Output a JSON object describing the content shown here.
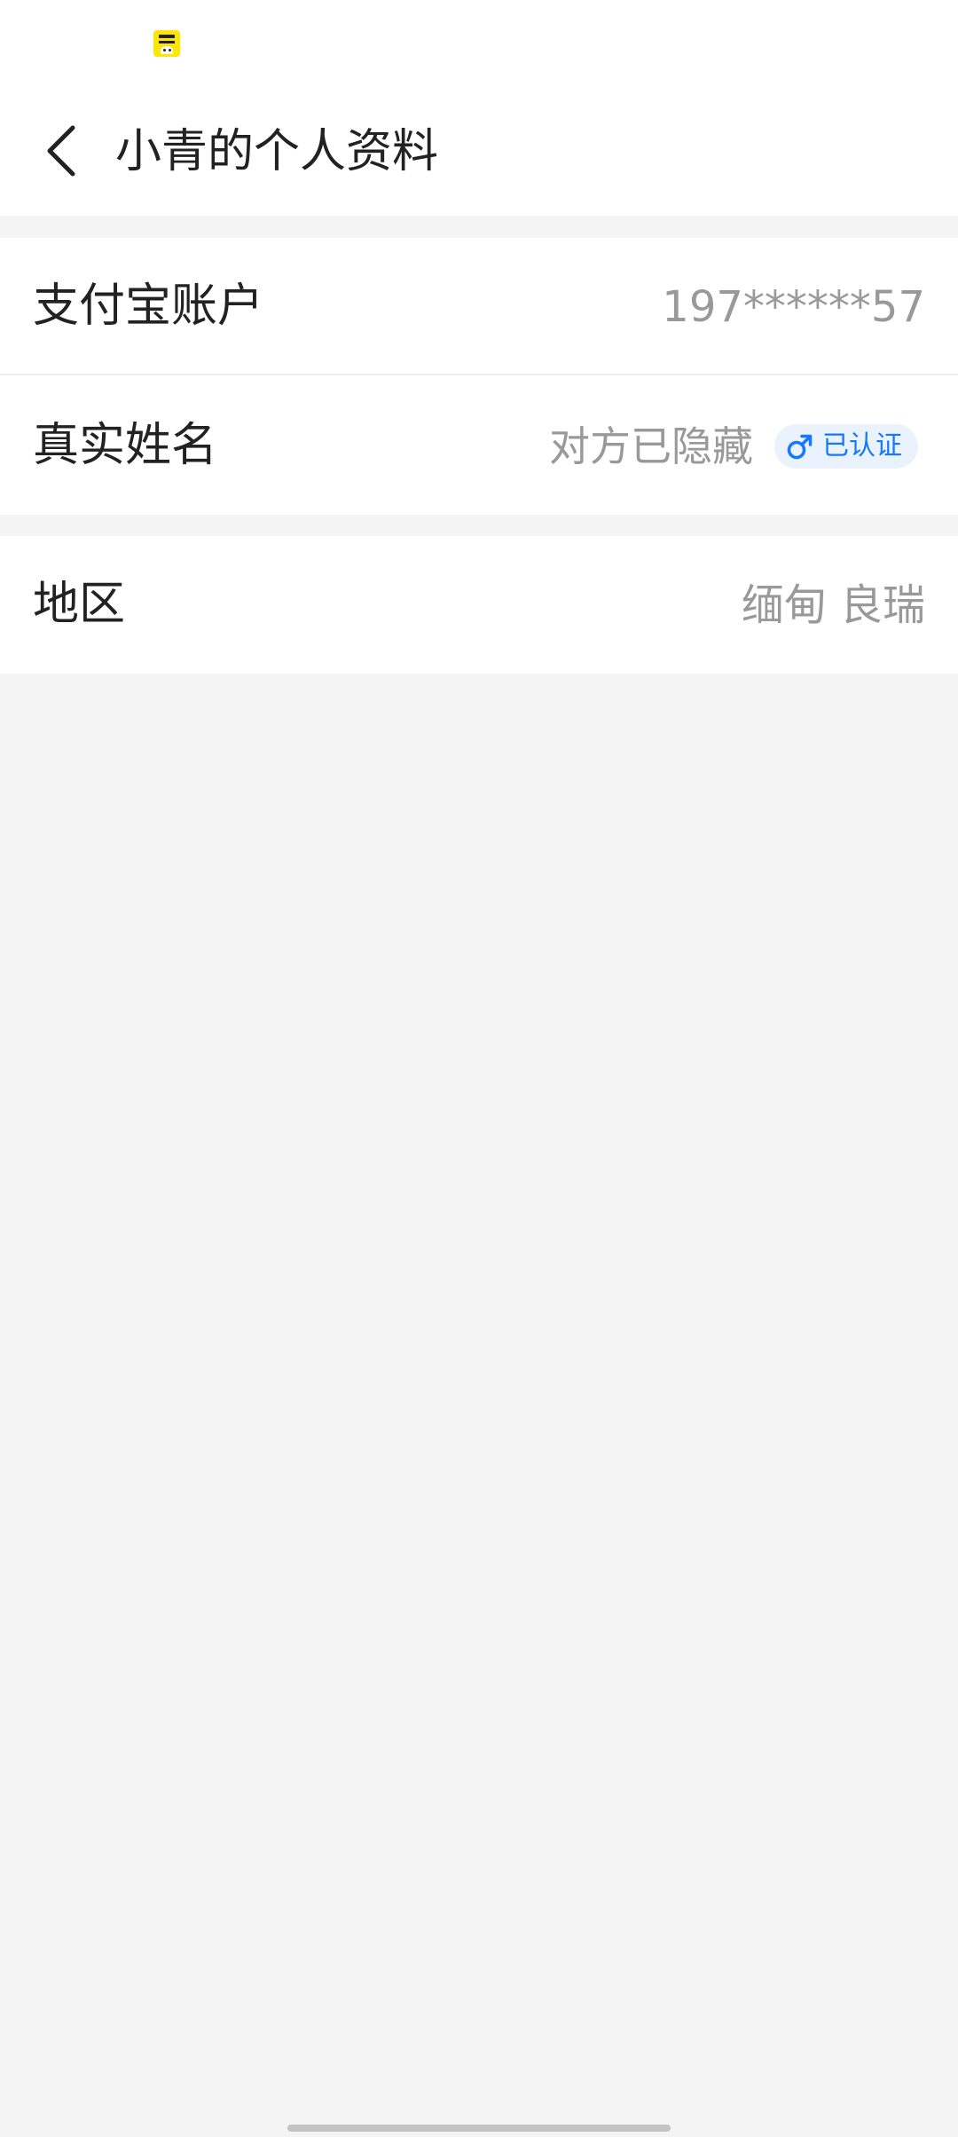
{
  "nav": {
    "title": "小青的个人资料"
  },
  "profile": {
    "account": {
      "label": "支付宝账户",
      "value": "197******57"
    },
    "real_name": {
      "label": "真实姓名",
      "value": "对方已隐藏",
      "badge": "已认证",
      "badge_icon": "male-gender-icon"
    },
    "region": {
      "label": "地区",
      "value": "缅甸 良瑞"
    }
  },
  "colors": {
    "accent": "#1677ff",
    "badge_bg": "#eaf3fd",
    "page_bg": "#f4f4f4",
    "card_bg": "#ffffff",
    "text_primary": "#222222",
    "text_secondary": "#999999"
  }
}
